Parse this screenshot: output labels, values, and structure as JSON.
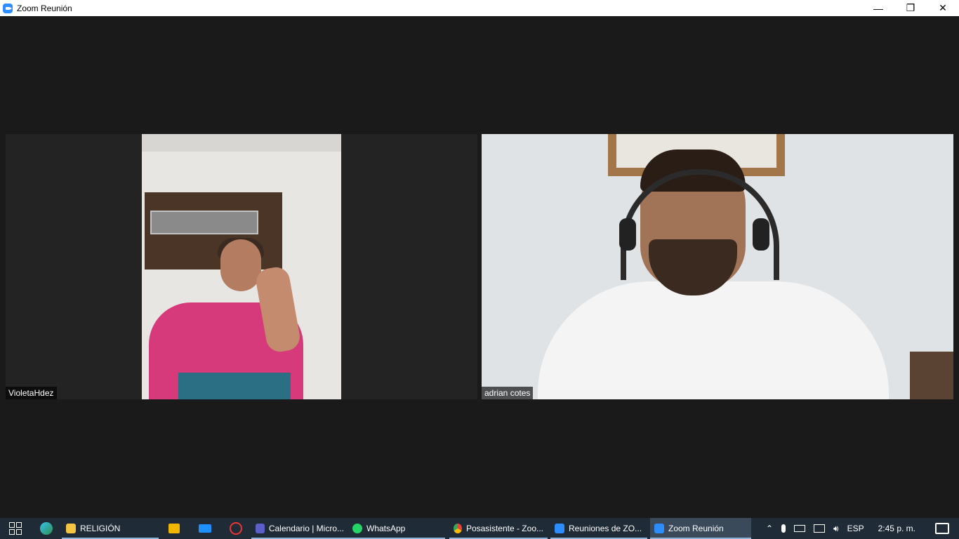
{
  "window": {
    "title": "Zoom Reunión",
    "minimize_icon": "minimize-icon",
    "restore_icon": "restore-icon",
    "close_icon": "close-icon",
    "minimize_glyph": "—",
    "restore_glyph": "❐",
    "close_glyph": "✕"
  },
  "participants": [
    {
      "name": "VioletaHdez"
    },
    {
      "name": "adrian cotes"
    }
  ],
  "taskbar": {
    "apps": [
      {
        "label": "RELIGIÓN",
        "color": "#f4c542"
      },
      {
        "label": "Calendario | Micro...",
        "color": "#5b5fc7"
      },
      {
        "label": "WhatsApp",
        "color": "#25d366"
      },
      {
        "label": "Posasistente - Zoo...",
        "color": "#ea4335"
      },
      {
        "label": "Reuniones de ZO...",
        "color": "#2d8cff"
      },
      {
        "label": "Zoom Reunión",
        "color": "#2d8cff"
      }
    ],
    "language": "ESP",
    "time": "2:45 p. m."
  }
}
